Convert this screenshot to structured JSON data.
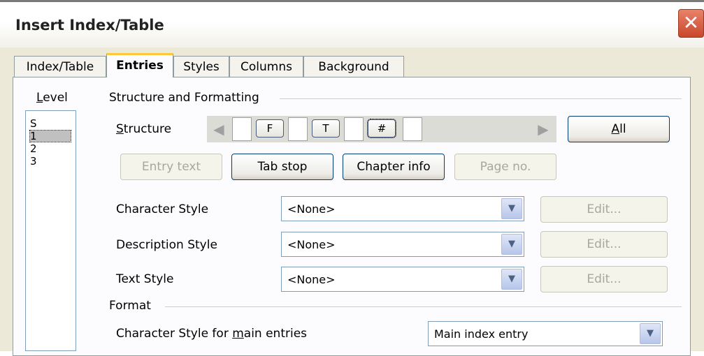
{
  "window": {
    "title": "Insert Index/Table",
    "close_glyph": "✕"
  },
  "tabs": [
    {
      "label": "Index/Table",
      "active": false
    },
    {
      "label": "Entries",
      "active": true
    },
    {
      "label": "Styles",
      "active": false
    },
    {
      "label": "Columns",
      "active": false
    },
    {
      "label": "Background",
      "active": false
    }
  ],
  "level": {
    "label": "Level",
    "items": [
      "S",
      "1",
      "2",
      "3"
    ],
    "selected": "1"
  },
  "structure_formatting": {
    "group_label": "Structure and Formatting",
    "structure_label": "Structure",
    "tokens": [
      "F",
      "T",
      "#"
    ],
    "all_button": "All",
    "buttons": {
      "entry_text": "Entry text",
      "tab_stop": "Tab stop",
      "chapter_info": "Chapter info",
      "page_no": "Page no."
    },
    "character_style": {
      "label": "Character Style",
      "value": "<None>",
      "edit": "Edit..."
    },
    "description_style": {
      "label": "Description Style",
      "value": "<None>",
      "edit": "Edit..."
    },
    "text_style": {
      "label": "Text Style",
      "value": "<None>",
      "edit": "Edit..."
    }
  },
  "format": {
    "group_label": "Format",
    "main_entries": {
      "label": "Character Style for main entries",
      "value": "Main index entry"
    }
  },
  "icons": {
    "close": "close-icon",
    "left": "arrow-left-icon",
    "right": "arrow-right-icon",
    "dropdown": "chevron-down-icon"
  },
  "colors": {
    "dialog_bg": "#ece9d8",
    "active_tab_accent": "#ffc83c",
    "close_button": "#c8472a"
  }
}
